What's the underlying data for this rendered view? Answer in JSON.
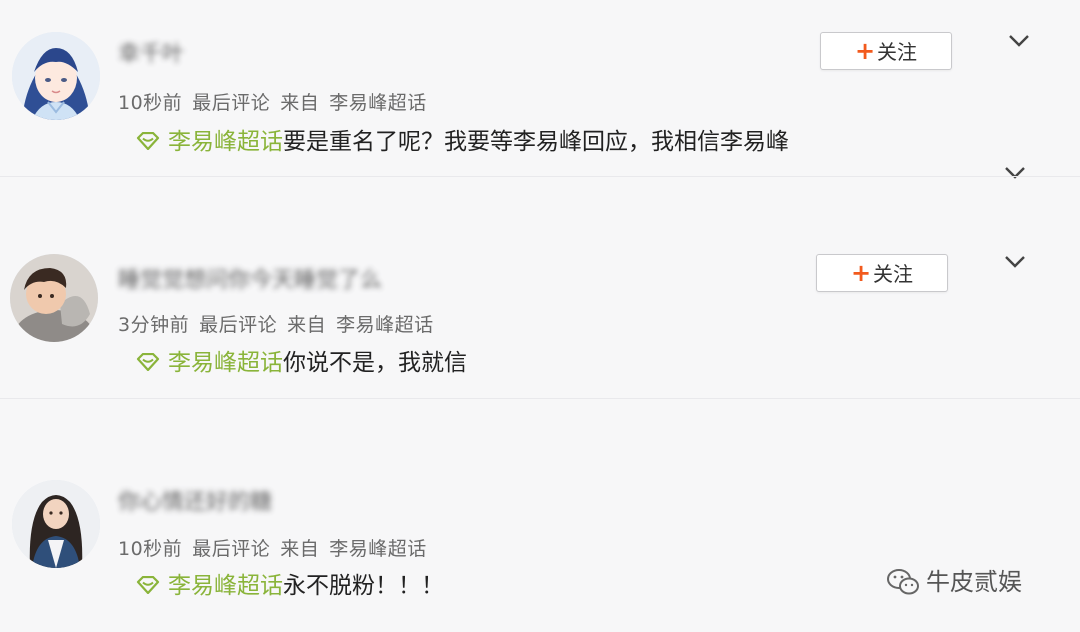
{
  "follow_label": "关注",
  "colors": {
    "topic": "#8ab43a",
    "follow_plus": "#f25a1d"
  },
  "posts": [
    {
      "username": "幸千叶",
      "meta": {
        "time": "10秒前",
        "action": "最后评论",
        "from": "来自",
        "source": "李易峰超话"
      },
      "topic": "李易峰超话",
      "text": "要是重名了呢？我要等李易峰回应，我相信李易峰"
    },
    {
      "username": "睡觉觉想问你今天睡觉了么",
      "meta": {
        "time": "3分钟前",
        "action": "最后评论",
        "from": "来自",
        "source": "李易峰超话"
      },
      "topic": "李易峰超话",
      "text": "你说不是，我就信"
    },
    {
      "username": "你心情还好的糖",
      "meta": {
        "time": "10秒前",
        "action": "最后评论",
        "from": "来自",
        "source": "李易峰超话"
      },
      "topic": "李易峰超话",
      "text": "永不脱粉！！！"
    }
  ],
  "watermark": {
    "icon": "wechat-icon",
    "text": "牛皮贰娱"
  }
}
